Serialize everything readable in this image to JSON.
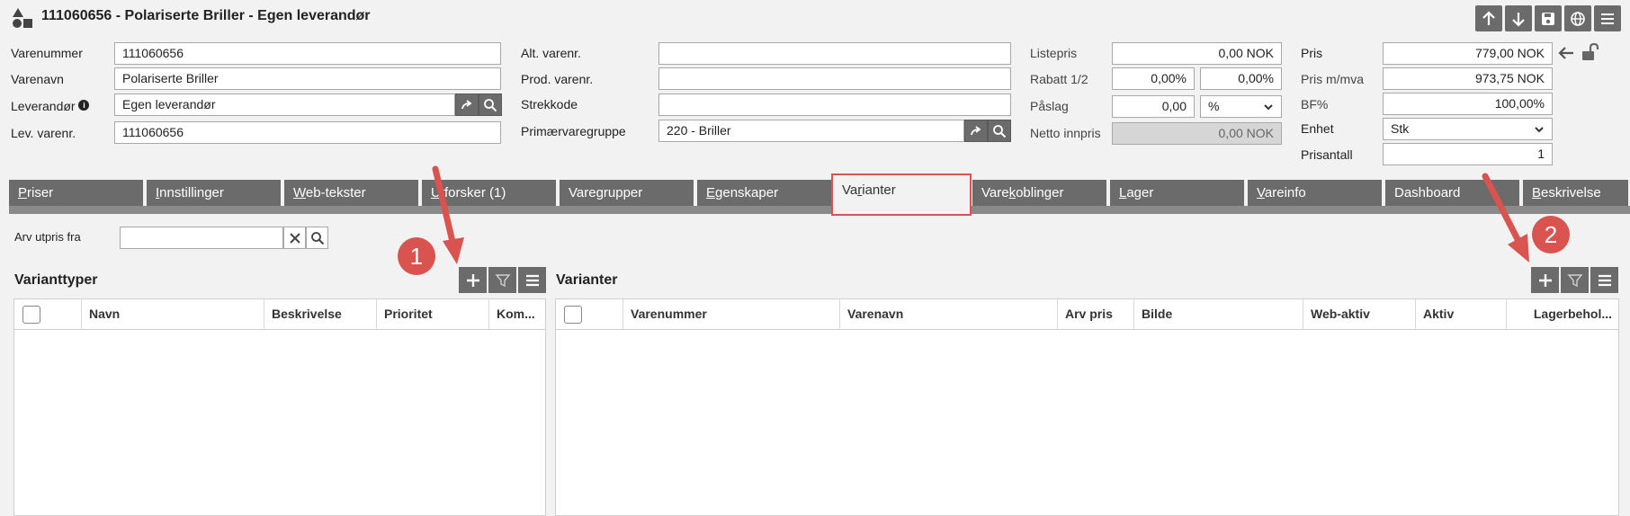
{
  "window": {
    "title": "111060656 - Polariserte Briller - Egen leverandør"
  },
  "toolbar": {
    "icons": [
      "arrow-up-icon",
      "arrow-down-icon",
      "save-icon",
      "globe-icon",
      "menu-icon"
    ]
  },
  "form": {
    "varenummer_label": "Varenummer",
    "varenummer_value": "111060656",
    "varenavn_label": "Varenavn",
    "varenavn_value": "Polariserte Briller",
    "leverandor_label": "Leverandør",
    "leverandor_value": "Egen leverandør",
    "lev_varenr_label": "Lev. varenr.",
    "lev_varenr_value": "111060656",
    "alt_varenr_label": "Alt. varenr.",
    "alt_varenr_value": "",
    "prod_varenr_label": "Prod. varenr.",
    "prod_varenr_value": "",
    "strekkode_label": "Strekkode",
    "strekkode_value": "",
    "primaervaregruppe_label": "Primærvaregruppe",
    "primaervaregruppe_value": "220 - Briller",
    "listepris_label": "Listepris",
    "listepris_value": "0,00 NOK",
    "rabatt_label": "Rabatt 1/2",
    "rabatt1_value": "0,00%",
    "rabatt2_value": "0,00%",
    "paslag_label": "Påslag",
    "paslag_value": "0,00",
    "paslag_unit": "%",
    "netto_label": "Netto innpris",
    "netto_value": "0,00 NOK",
    "pris_label": "Pris",
    "pris_value": "779,00 NOK",
    "pris_mva_label": "Pris m/mva",
    "pris_mva_value": "973,75 NOK",
    "bf_label": "BF%",
    "bf_value": "100,00%",
    "enhet_label": "Enhet",
    "enhet_value": "Stk",
    "prisantall_label": "Prisantall",
    "prisantall_value": "1"
  },
  "tabs": [
    {
      "label": "Priser",
      "ul": "P",
      "rest": "riser"
    },
    {
      "label": "Innstillinger",
      "ul": "I",
      "rest": "nnstillinger"
    },
    {
      "label": "Web-tekster",
      "ul": "W",
      "rest": "eb-tekster"
    },
    {
      "label": "Utforsker (1)",
      "ul": "U",
      "rest": "tforsker (1)"
    },
    {
      "label": "Varegrupper",
      "ul": "",
      "rest": "Varegrupper"
    },
    {
      "label": "Egenskaper",
      "ul": "E",
      "rest": "genskaper"
    },
    {
      "label": "Varianter",
      "pre": "Va",
      "ul": "r",
      "rest": "ianter"
    },
    {
      "label": "Varekoblinger",
      "pre": "Vare",
      "ul": "k",
      "rest": "oblinger"
    },
    {
      "label": "Lager",
      "ul": "L",
      "rest": "ager"
    },
    {
      "label": "Vareinfo",
      "ul": "V",
      "rest": "areinfo"
    },
    {
      "label": "Dashboard",
      "ul": "",
      "rest": "Dashboard"
    },
    {
      "label": "Beskrivelse",
      "ul": "B",
      "rest": "eskrivelse"
    }
  ],
  "variants": {
    "arv_utpris_label": "Arv utpris fra",
    "arv_utpris_value": "",
    "varianttyper_title": "Varianttyper",
    "varianter_title": "Varianter",
    "varianttyper_columns": [
      "Navn",
      "Beskrivelse",
      "Prioritet",
      "Kom..."
    ],
    "varianter_columns": [
      "Varenummer",
      "Varenavn",
      "Arv pris",
      "Bilde",
      "Web-aktiv",
      "Aktiv",
      "Lagerbehol..."
    ]
  },
  "annotations": {
    "badge1": "1",
    "badge2": "2",
    "accent_color": "#d9534f"
  }
}
